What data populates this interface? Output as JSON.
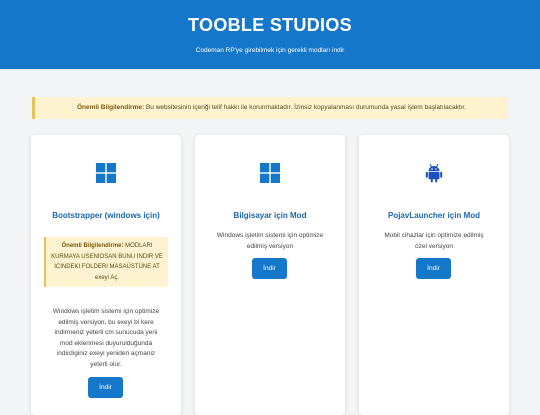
{
  "header": {
    "title": "TOOBLE STUDIOS",
    "subtitle": "Codeman RP'ye girebilmek için gerekli modları indir"
  },
  "notice": {
    "bold": "Önemli Bilgilendirme:",
    "text": " Bu websitesinin içeriği telif hakkı ile korunmaktadır. İzinsiz kopyalanması durumunda yasal işlem başlatılacaktır."
  },
  "cards": [
    {
      "title": "Bootstrapper (windows için)",
      "icon": "windows-icon",
      "warning_bold": "Önemli Bilgilendirme:",
      "warning_text": " MODLARI KURMAYA USENIOSAN BUNU INDIR VE ICINDEKI FOLDERI MASAÜSTÜNE AT exeyi Aç.",
      "description": "Windows işletim sistemi için optimize edilmiş versiyon, bu exeyi bi kere indirmeniz yeterli cm sunucuda yeni mod eklenmesi duyurulduğunda indirdiginiz exeyi yeniden açmaniz yeterli olur.",
      "button": "İndir"
    },
    {
      "title": "Bilgisayar için Mod",
      "icon": "windows-icon",
      "description": "Windows işletim sistemi için optimize edilmiş versiyon",
      "button": "İndir"
    },
    {
      "title": "PojavLauncher için Mod",
      "icon": "android-icon",
      "description": "Mobil cihazlar için optimize edilmiş özel versiyon",
      "button": "İndir"
    }
  ],
  "colors": {
    "primary": "#1577c9",
    "title_blue": "#1a68ad",
    "notice_bg": "#fdf3d0",
    "android": "#1e4fc0"
  }
}
